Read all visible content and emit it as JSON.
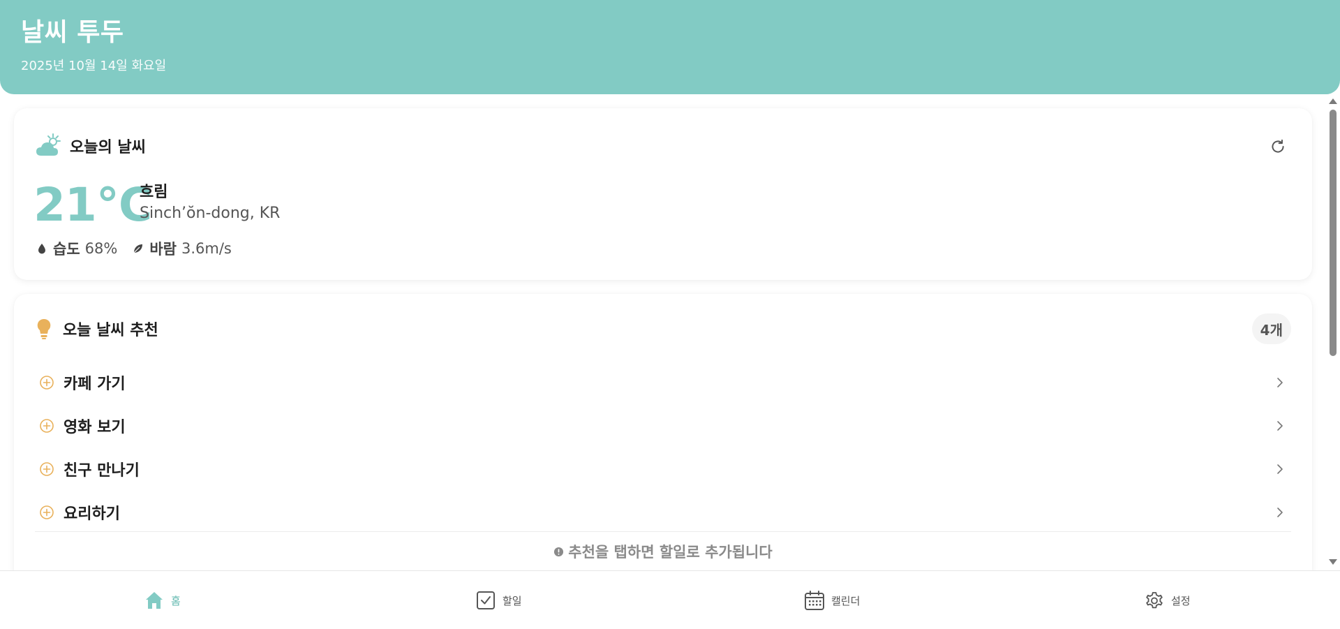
{
  "header": {
    "title": "날씨 투두",
    "date": "2025년 10월 14일 화요일"
  },
  "weather": {
    "title": "오늘의 날씨",
    "icon": "partly-cloudy-icon",
    "temperature": "21°C",
    "condition": "흐림",
    "location": "Sinch’ŏn-dong, KR",
    "humidity_label": "습도",
    "humidity_value": "68%",
    "wind_label": "바람",
    "wind_value": "3.6m/s"
  },
  "recommendations": {
    "title": "오늘 날씨 추천",
    "count": "4개",
    "items": [
      {
        "label": "카페 가기"
      },
      {
        "label": "영화 보기"
      },
      {
        "label": "친구 만나기"
      },
      {
        "label": "요리하기"
      }
    ],
    "hint": "추천을 탭하면 할일로 추가됩니다"
  },
  "nav": {
    "home": "홈",
    "todo": "할일",
    "calendar": "캘린더",
    "settings": "설정"
  },
  "colors": {
    "accent": "#82cbc4",
    "bulb": "#e9b15b"
  }
}
